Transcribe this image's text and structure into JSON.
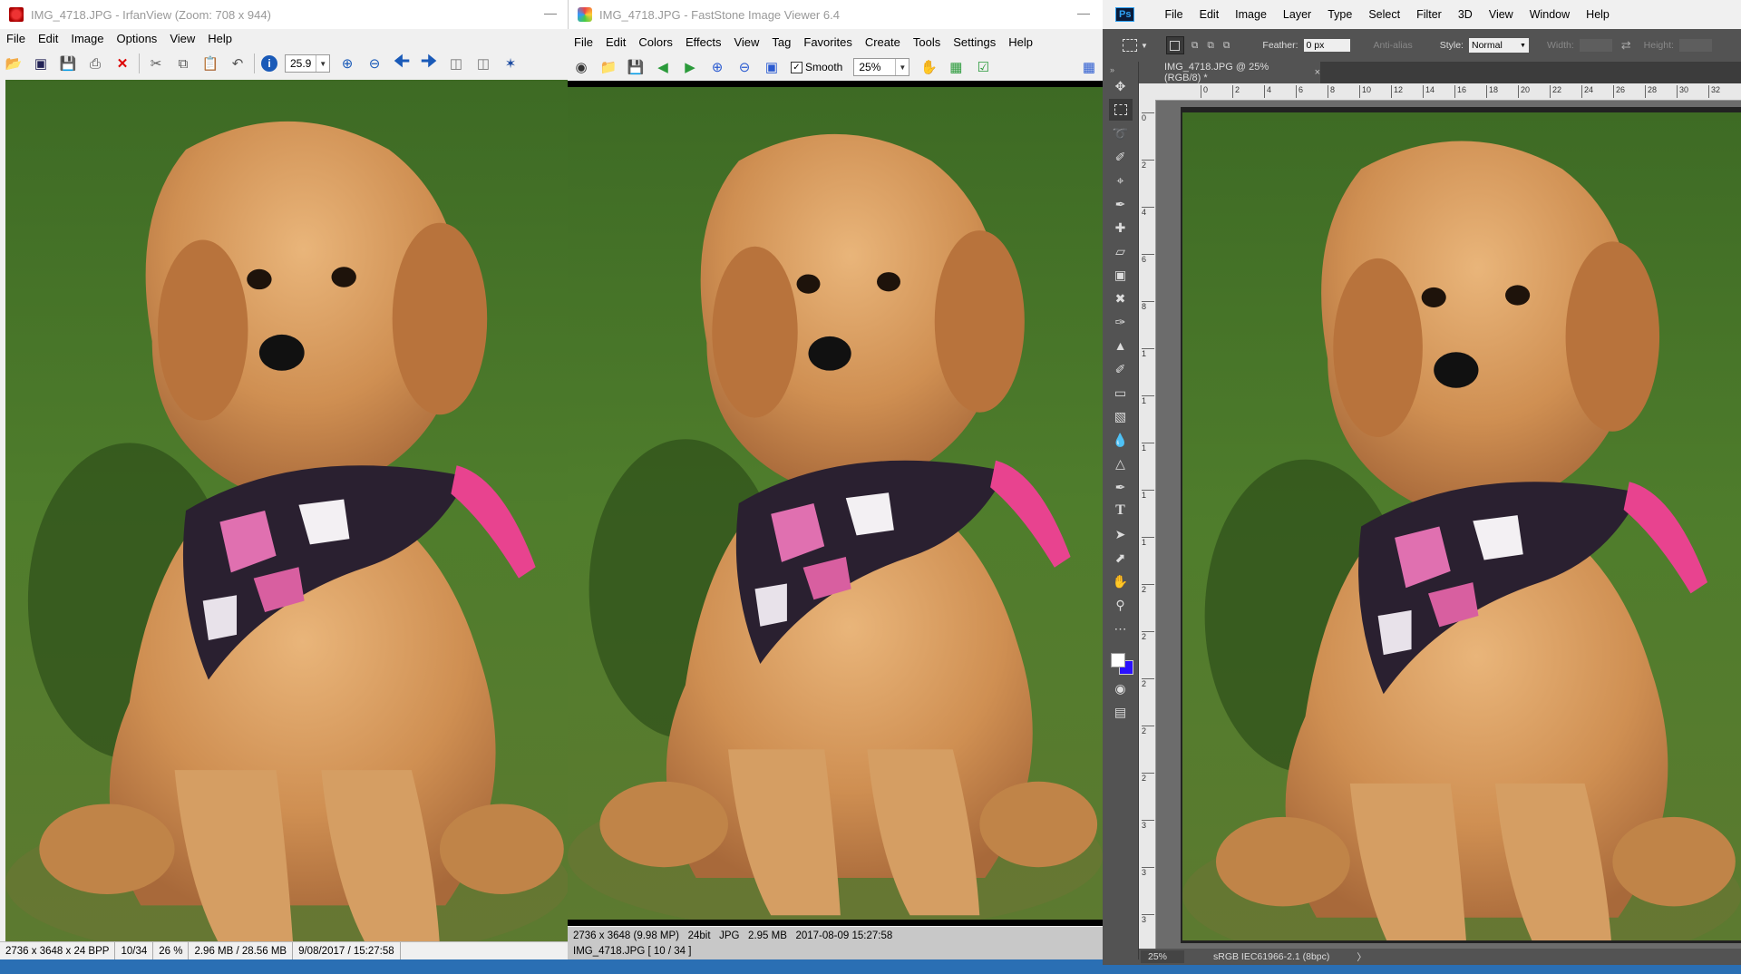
{
  "desktop": {
    "background": "#2a6fb4"
  },
  "irfanview": {
    "title": "IMG_4718.JPG - IrfanView (Zoom: 708 x 944)",
    "menu": [
      "File",
      "Edit",
      "Image",
      "Options",
      "View",
      "Help"
    ],
    "zoom_value": "25.9",
    "status": [
      "2736 x 3648 x 24 BPP",
      "10/34",
      "26 %",
      "2.96 MB / 28.56 MB",
      "9/08/2017 / 15:27:58"
    ]
  },
  "faststone": {
    "title": "IMG_4718.JPG - FastStone Image Viewer 6.4",
    "menu": [
      "File",
      "Edit",
      "Colors",
      "Effects",
      "View",
      "Tag",
      "Favorites",
      "Create",
      "Tools",
      "Settings",
      "Help"
    ],
    "smooth_label": "Smooth",
    "smooth_checked": true,
    "zoom_value": "25%",
    "info_line": "2736 x 3648 (9.98 MP)   24bit   JPG   2.95 MB   2017-08-09 15:27:58",
    "file_line": "IMG_4718.JPG [ 10 / 34 ]"
  },
  "photoshop": {
    "logo": "Ps",
    "menu": [
      "File",
      "Edit",
      "Image",
      "Layer",
      "Type",
      "Select",
      "Filter",
      "3D",
      "View",
      "Window",
      "Help"
    ],
    "options": {
      "feather_label": "Feather:",
      "feather_value": "0 px",
      "antialias_label": "Anti-alias",
      "style_label": "Style:",
      "style_value": "Normal",
      "width_label": "Width:",
      "height_label": "Height:"
    },
    "doc_tab": "IMG_4718.JPG @ 25% (RGB/8) *",
    "ruler_numbers": [
      "0",
      "2",
      "4",
      "6",
      "8",
      "10",
      "12",
      "14",
      "16",
      "18",
      "20",
      "22",
      "24",
      "26",
      "28",
      "30",
      "32"
    ],
    "vruler_numbers": [
      "0",
      "2",
      "4",
      "6",
      "8",
      "1",
      "1",
      "1",
      "1",
      "1",
      "2",
      "2",
      "2",
      "2",
      "2",
      "3",
      "3",
      "3"
    ],
    "status_zoom": "25%",
    "status_profile": "sRGB IEC61966-2.1 (8bpc)",
    "status_arrow": "〉",
    "tools": [
      "move-icon",
      "marquee-icon",
      "lasso-icon",
      "quick-select-icon",
      "crop-icon",
      "eyedropper-icon",
      "healing-icon",
      "ruler-icon",
      "frame-icon",
      "transform-icon",
      "brush-icon",
      "stamp-icon",
      "history-brush-icon",
      "eraser-icon",
      "gradient-icon",
      "blur-icon",
      "dodge-icon",
      "pen-icon",
      "type-icon",
      "path-select-icon",
      "pointer-icon",
      "hand-icon",
      "zoom-icon",
      "more-icon"
    ]
  }
}
